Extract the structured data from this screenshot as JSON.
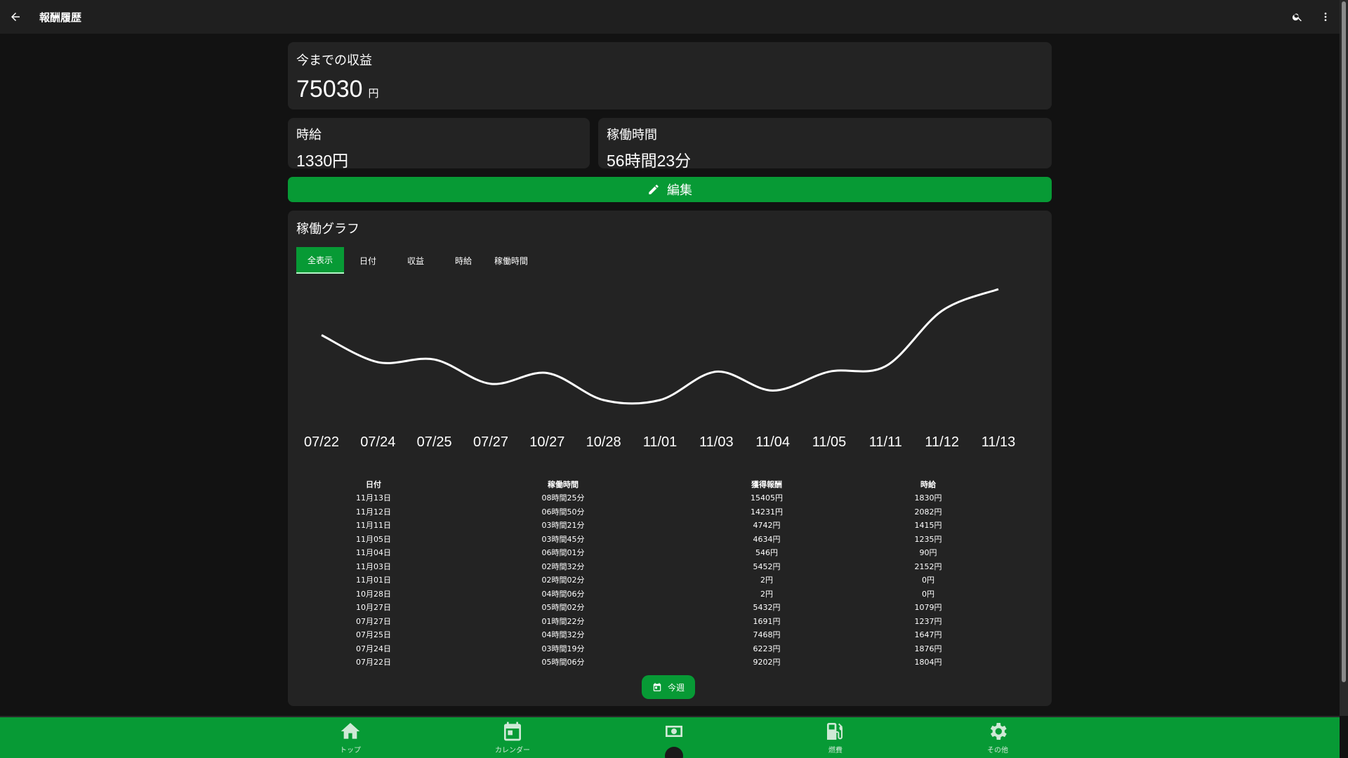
{
  "appbar": {
    "title": "報酬履歴"
  },
  "earnings": {
    "label": "今までの収益",
    "amount": "75030",
    "unit": "円"
  },
  "stats": {
    "wage_label": "時給",
    "wage_value": "1330円",
    "hours_label": "稼働時間",
    "hours_value": "56時間23分"
  },
  "edit_button": {
    "label": "編集",
    "color": "#079a35"
  },
  "graph": {
    "title": "稼働グラフ",
    "tabs": [
      "全表示",
      "日付",
      "収益",
      "時給",
      "稼働時間"
    ],
    "active_tab": 0
  },
  "chart_data": {
    "type": "line",
    "categories": [
      "07/22",
      "07/24",
      "07/25",
      "07/27",
      "10/27",
      "10/28",
      "11/01",
      "11/03",
      "11/04",
      "11/05",
      "11/11",
      "11/12",
      "11/13"
    ],
    "values": [
      5,
      3,
      3.2,
      1.4,
      2.2,
      0.2,
      0.2,
      2.3,
      0.9,
      2.3,
      2.7,
      6.8,
      8.4
    ],
    "line_color": "#ffffff",
    "grid": false
  },
  "table": {
    "headers": [
      "日付",
      "稼働時間",
      "獲得報酬",
      "時給"
    ],
    "rows": [
      [
        "11月13日",
        "08時間25分",
        "15405円",
        "1830円"
      ],
      [
        "11月12日",
        "06時間50分",
        "14231円",
        "2082円"
      ],
      [
        "11月11日",
        "03時間21分",
        "4742円",
        "1415円"
      ],
      [
        "11月05日",
        "03時間45分",
        "4634円",
        "1235円"
      ],
      [
        "11月04日",
        "06時間01分",
        "546円",
        "90円"
      ],
      [
        "11月03日",
        "02時間32分",
        "5452円",
        "2152円"
      ],
      [
        "11月01日",
        "02時間02分",
        "2円",
        "0円"
      ],
      [
        "10月28日",
        "04時間06分",
        "2円",
        "0円"
      ],
      [
        "10月27日",
        "05時間02分",
        "5432円",
        "1079円"
      ],
      [
        "07月27日",
        "01時間22分",
        "1691円",
        "1237円"
      ],
      [
        "07月25日",
        "04時間32分",
        "7468円",
        "1647円"
      ],
      [
        "07月24日",
        "03時間19分",
        "6223円",
        "1876円"
      ],
      [
        "07月22日",
        "05時間06分",
        "9202円",
        "1804円"
      ]
    ]
  },
  "week_button": {
    "label": "今週"
  },
  "bottom_nav": {
    "items": [
      {
        "label": "トップ",
        "icon": "home-icon"
      },
      {
        "label": "カレンダー",
        "icon": "calendar-icon"
      },
      {
        "label": "",
        "icon": "money-icon"
      },
      {
        "label": "燃費",
        "icon": "fuel-icon"
      },
      {
        "label": "その他",
        "icon": "gear-icon"
      }
    ]
  }
}
